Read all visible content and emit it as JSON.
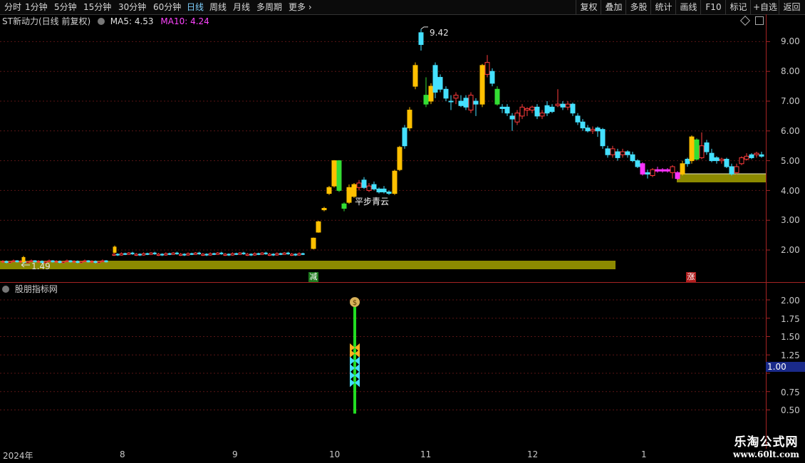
{
  "toolbar": {
    "periods": [
      "分时",
      "1分钟",
      "5分钟",
      "15分钟",
      "30分钟",
      "60分钟",
      "日线",
      "周线",
      "月线",
      "多周期",
      "更多"
    ],
    "active_period": "日线",
    "right_buttons": [
      "复权",
      "叠加",
      "多股",
      "统计",
      "画线",
      "F10",
      "标记",
      "+自选",
      "返回"
    ]
  },
  "main_legend": {
    "title": "ST新动力(日线 前复权)",
    "ma5_label": "MA5: 4.53",
    "ma10_label": "MA10: 4.24",
    "ma5_color": "#e0e0e0",
    "ma10_color": "#ff44ff"
  },
  "sub_legend": {
    "title": "股朋指标网"
  },
  "annotations": {
    "high_label": "9.42",
    "low_label": "1.49",
    "pattern_label": "平步青云",
    "signal_reduce": "减",
    "signal_rise": "涨"
  },
  "price_axis": {
    "ticks": [
      "9.00",
      "8.00",
      "7.00",
      "6.00",
      "5.00",
      "4.00",
      "3.00",
      "2.00"
    ]
  },
  "indicator_axis": {
    "ticks": [
      "2.00",
      "1.75",
      "1.50",
      "1.25",
      "1.00",
      "0.75",
      "0.50"
    ],
    "current_value": "1.00"
  },
  "date_axis": {
    "labels": [
      "2024年",
      "8",
      "9",
      "10",
      "11",
      "12",
      "1"
    ]
  },
  "watermark": {
    "title": "乐淘公式网",
    "url": "www.60lt.com"
  },
  "colors": {
    "up": "#ff3b3b",
    "down": "#44e0ff",
    "highlight_up": "#ffc000",
    "highlight_down": "#33dd33",
    "magenta": "#ff33ff",
    "band": "#8c8a00",
    "grid": "#5a1515",
    "indicator_bar": "#22dd22"
  }
}
